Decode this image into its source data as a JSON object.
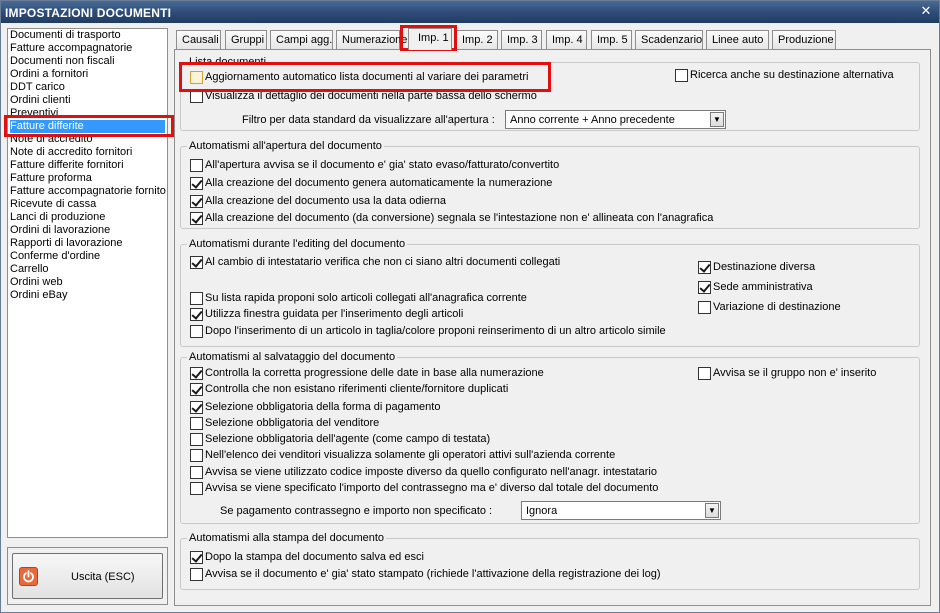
{
  "window": {
    "title": "IMPOSTAZIONI DOCUMENTI",
    "close_glyph": "✕"
  },
  "sidebar": {
    "items": [
      "Documenti di trasporto",
      "Fatture accompagnatorie",
      "Documenti non fiscali",
      "Ordini a fornitori",
      "DDT carico",
      "Ordini clienti",
      "Preventivi",
      "Fatture differite",
      "Note di accredito",
      "Note di accredito fornitori",
      "Fatture differite fornitori",
      "Fatture proforma",
      "Fatture accompagnatorie fornito",
      "Ricevute di cassa",
      "Lanci di produzione",
      "Ordini di lavorazione",
      "Rapporti di lavorazione",
      "Conferme d'ordine",
      "Carrello",
      "Ordini web",
      "Ordini eBay"
    ],
    "selected": "Fatture differite"
  },
  "exit": {
    "label": "Uscita (ESC)",
    "icon": "power-icon"
  },
  "tabs": [
    "Causali",
    "Gruppi",
    "Campi agg.",
    "Numerazione",
    "Imp. 1",
    "Imp. 2",
    "Imp. 3",
    "Imp. 4",
    "Imp. 5",
    "Scadenzario",
    "Linee auto",
    "Produzione"
  ],
  "active_tab": "Imp. 1",
  "groups": {
    "lista": {
      "title": "Lista documenti",
      "auto_update": {
        "label": "Aggiornamento automatico lista documenti al variare dei parametri",
        "checked": false
      },
      "show_detail": {
        "label": "Visualizza il dettaglio dei documenti nella parte bassa dello schermo",
        "checked": false
      },
      "alt_search": {
        "label": "Ricerca anche su destinazione alternativa",
        "checked": false
      },
      "filter_label": "Filtro per data standard da visualizzare all'apertura :",
      "filter_value": "Anno corrente + Anno precedente"
    },
    "apertura": {
      "title": "Automatismi all'apertura del documento",
      "items": [
        {
          "label": "All'apertura avvisa se il documento e' gia' stato evaso/fatturato/convertito",
          "checked": false
        },
        {
          "label": "Alla creazione del documento genera automaticamente la numerazione",
          "checked": true
        },
        {
          "label": "Alla creazione del documento usa la data odierna",
          "checked": true
        },
        {
          "label": "Alla creazione del documento (da conversione) segnala se l'intestazione non e' allineata con l'anagrafica",
          "checked": true
        }
      ]
    },
    "editing": {
      "title": "Automatismi durante l'editing del documento",
      "change_holder": {
        "label": "Al cambio di intestatario verifica che non ci siano altri documenti collegati",
        "checked": true
      },
      "dest_diversa": {
        "label": "Destinazione diversa",
        "checked": true
      },
      "sede_amm": {
        "label": "Sede amministrativa",
        "checked": true
      },
      "var_dest": {
        "label": "Variazione di destinazione",
        "checked": false
      },
      "quick_list": {
        "label": "Su lista rapida proponi solo articoli collegati all'anagrafica corrente",
        "checked": false
      },
      "wizard": {
        "label": "Utilizza finestra guidata per l'inserimento degli articoli",
        "checked": true
      },
      "reinsert": {
        "label": "Dopo l'inserimento di un articolo in taglia/colore proponi reinserimento di un altro articolo simile",
        "checked": false
      }
    },
    "salvataggio": {
      "title": "Automatismi al salvataggio del documento",
      "items": [
        {
          "label": "Controlla la corretta progressione delle date in base alla numerazione",
          "checked": true
        },
        {
          "label": "Controlla che non esistano riferimenti cliente/fornitore duplicati",
          "checked": true
        },
        {
          "label": "Selezione obbligatoria della forma di pagamento",
          "checked": true
        },
        {
          "label": "Selezione obbligatoria del venditore",
          "checked": false
        },
        {
          "label": "Selezione obbligatoria dell'agente (come campo di testata)",
          "checked": false
        },
        {
          "label": "Nell'elenco dei venditori visualizza solamente gli operatori attivi sull'azienda corrente",
          "checked": false
        },
        {
          "label": "Avvisa se viene utilizzato codice imposte diverso da quello configurato nell'anagr. intestatario",
          "checked": false
        },
        {
          "label": "Avvisa se viene specificato l'importo del contrassegno ma e' diverso dal totale del documento",
          "checked": false
        }
      ],
      "group_warn": {
        "label": "Avvisa se il gruppo non e' inserito",
        "checked": false
      },
      "payment_label": "Se pagamento contrassegno e importo non specificato :",
      "payment_value": "Ignora"
    },
    "stampa": {
      "title": "Automatismi alla stampa del documento",
      "items": [
        {
          "label": "Dopo la stampa del documento salva ed esci",
          "checked": true
        },
        {
          "label": "Avvisa se il documento e' gia' stato stampato (richiede l'attivazione della registrazione dei log)",
          "checked": false
        }
      ]
    }
  },
  "colors": {
    "titlebar": "#2e4d79",
    "selection": "#3399ff",
    "highlight": "#e01010"
  }
}
